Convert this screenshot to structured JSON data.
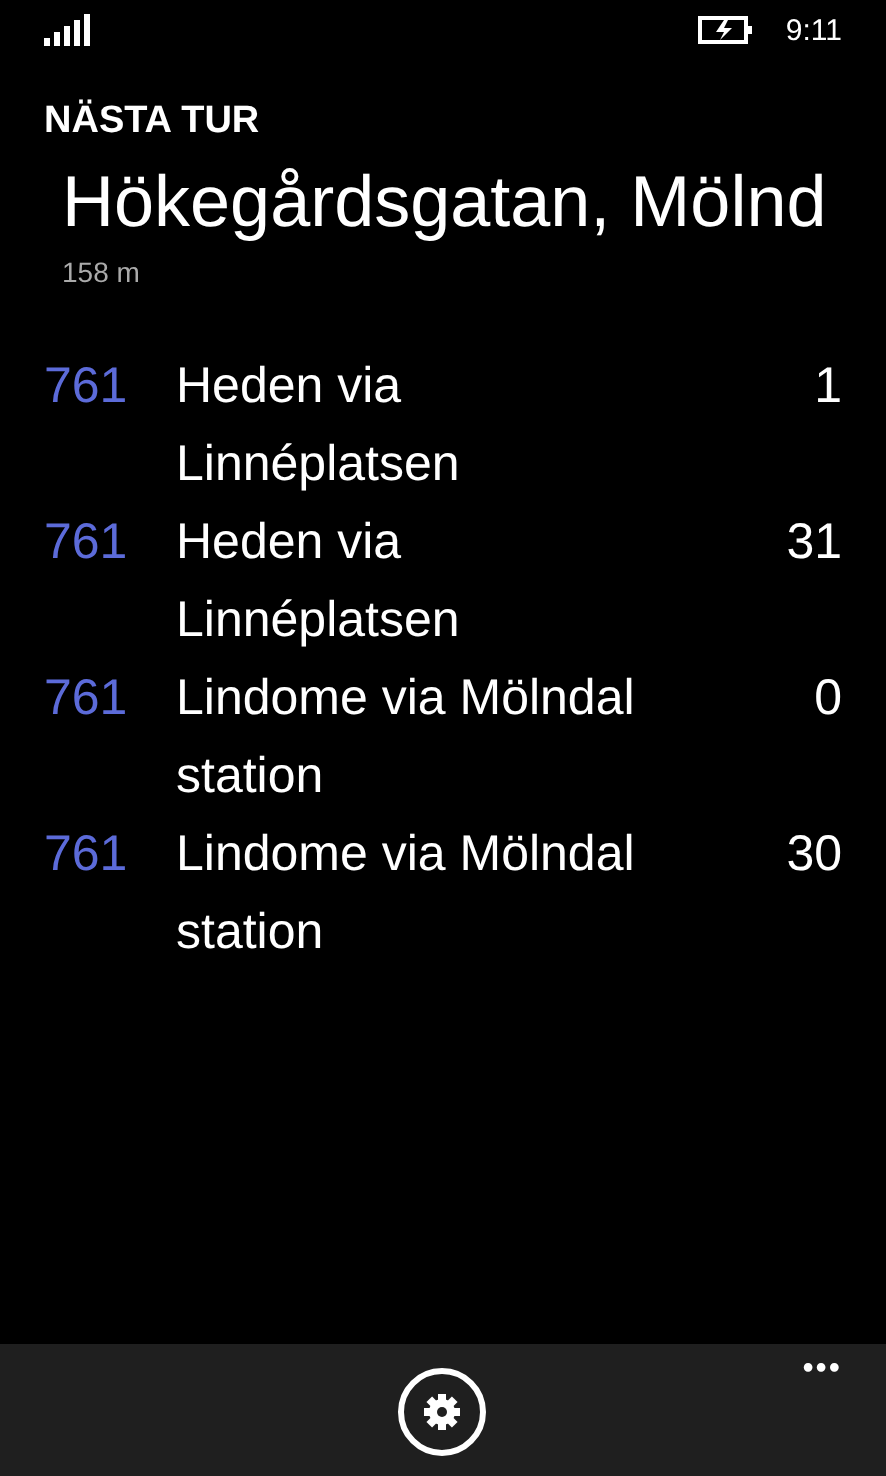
{
  "status_bar": {
    "time": "9:11"
  },
  "header": {
    "app_title": "NÄSTA TUR",
    "stop_name": "Hökegårdsgatan, Mölnd",
    "distance": "158 m"
  },
  "departures": [
    {
      "route": "761",
      "destination": "Heden via Linnéplatsen",
      "minutes": "1"
    },
    {
      "route": "761",
      "destination": "Heden via Linnéplatsen",
      "minutes": "31"
    },
    {
      "route": "761",
      "destination": "Lindome via Mölndal station",
      "minutes": "0"
    },
    {
      "route": "761",
      "destination": "Lindome via Mölndal station",
      "minutes": "30"
    }
  ],
  "app_bar": {
    "more": "•••"
  }
}
